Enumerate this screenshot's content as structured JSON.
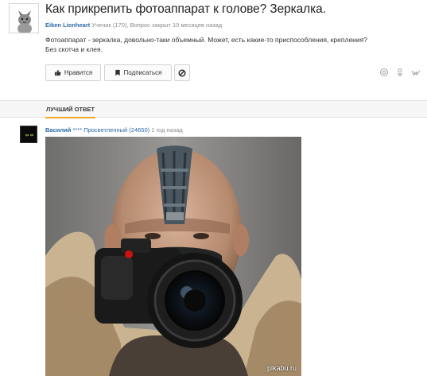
{
  "question": {
    "title": "Как прикрепить фотоаппарат к голове? Зеркалка.",
    "author": "Eiken Lionheart",
    "author_meta": " Ученик (170), Вопрос закрыт 10 месяцев назад",
    "body_line1": "Фотоаппарат - зеркалка, довольно-таки объемный. Может, есть какие-то приспособления, крепления?",
    "body_line2": "Без скотча и клея."
  },
  "actions": {
    "like_label": "Нравится",
    "subscribe_label": "Подписаться",
    "like_icon": "thumbs-up-icon",
    "subscribe_icon": "bookmark-icon",
    "block_icon": "block-icon"
  },
  "share": {
    "icons": [
      "mail-icon",
      "odnoklassniki-icon",
      "vk-icon"
    ]
  },
  "best_answer": {
    "tab_label": "ЛУЧШИЙ ОТВЕТ",
    "author": "Василий",
    "rank": " **** Просветленный (24650)",
    "time": " 1 год назад"
  },
  "watermark": "pikabu.ru",
  "colors": {
    "link": "#2b6aa6",
    "tab_accent": "#f5a623",
    "title": "#222222"
  }
}
